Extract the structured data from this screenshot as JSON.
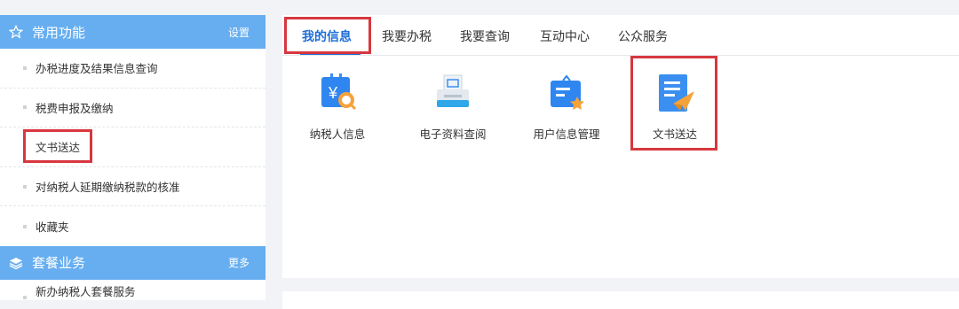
{
  "sidebar": {
    "common": {
      "title": "常用功能",
      "action": "设置",
      "items": [
        "办税进度及结果信息查询",
        "税费申报及缴纳",
        "文书送达",
        "对纳税人延期缴纳税款的核准",
        "收藏夹"
      ]
    },
    "package": {
      "title": "套餐业务",
      "action": "更多",
      "items": [
        "新办纳税人套餐服务"
      ]
    }
  },
  "main": {
    "tabs": [
      "我的信息",
      "我要办税",
      "我要查询",
      "互动中心",
      "公众服务"
    ],
    "active_tab": "我的信息",
    "icons": [
      {
        "label": "纳税人信息",
        "icon": "taxpayer-info-icon"
      },
      {
        "label": "电子资料查阅",
        "icon": "e-document-icon"
      },
      {
        "label": "用户信息管理",
        "icon": "user-info-manage-icon"
      },
      {
        "label": "文书送达",
        "icon": "document-delivery-icon"
      }
    ]
  },
  "colors": {
    "header": "#66aef0",
    "accent": "#1e6fd8",
    "highlight": "#d7373f"
  }
}
